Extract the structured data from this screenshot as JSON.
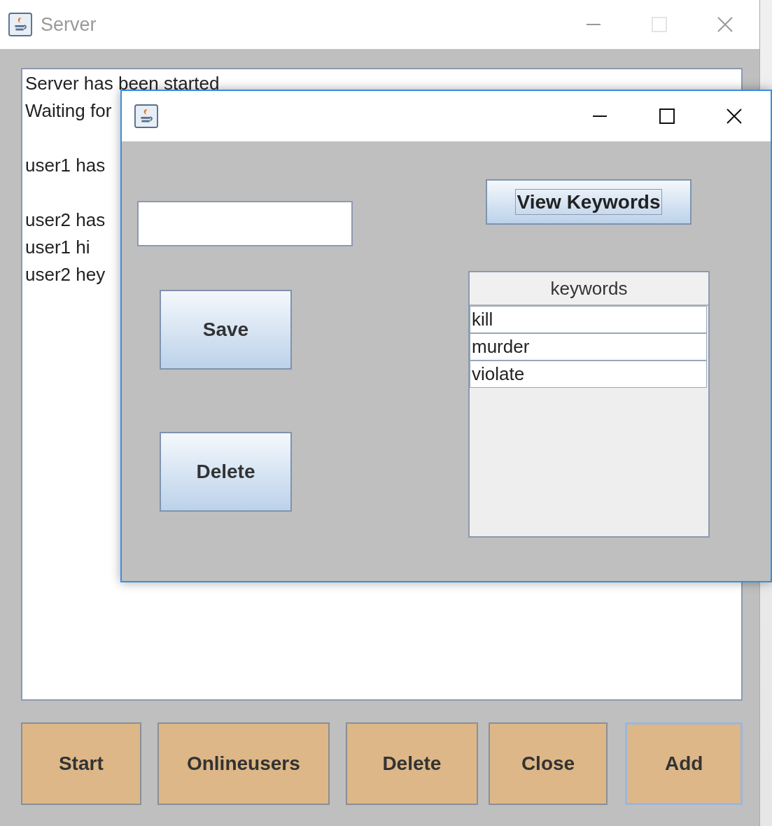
{
  "window": {
    "title": "Server"
  },
  "log": {
    "lines": [
      {
        "kind": "text",
        "text": "Server has been started"
      },
      {
        "kind": "text",
        "text": "Waiting for"
      },
      {
        "kind": "blank"
      },
      {
        "kind": "text",
        "text": "user1  has"
      },
      {
        "kind": "blank"
      },
      {
        "kind": "text",
        "text": "user2  has"
      },
      {
        "kind": "text",
        "text": "user1 hi"
      },
      {
        "kind": "text",
        "text": "user2 hey"
      }
    ]
  },
  "buttons": [
    {
      "label": "Start",
      "focused": false
    },
    {
      "label": "Onlineusers",
      "focused": false
    },
    {
      "label": "Delete",
      "focused": false
    },
    {
      "label": "Close",
      "focused": false
    },
    {
      "label": "Add",
      "focused": true
    }
  ],
  "dialog": {
    "view_button": {
      "label": "View Keywords",
      "focused": true
    },
    "save_button": "Save",
    "delete_button": "Delete",
    "table": {
      "columns": [
        "keywords"
      ],
      "rows": [
        "kill",
        "murder",
        "violate"
      ]
    }
  }
}
